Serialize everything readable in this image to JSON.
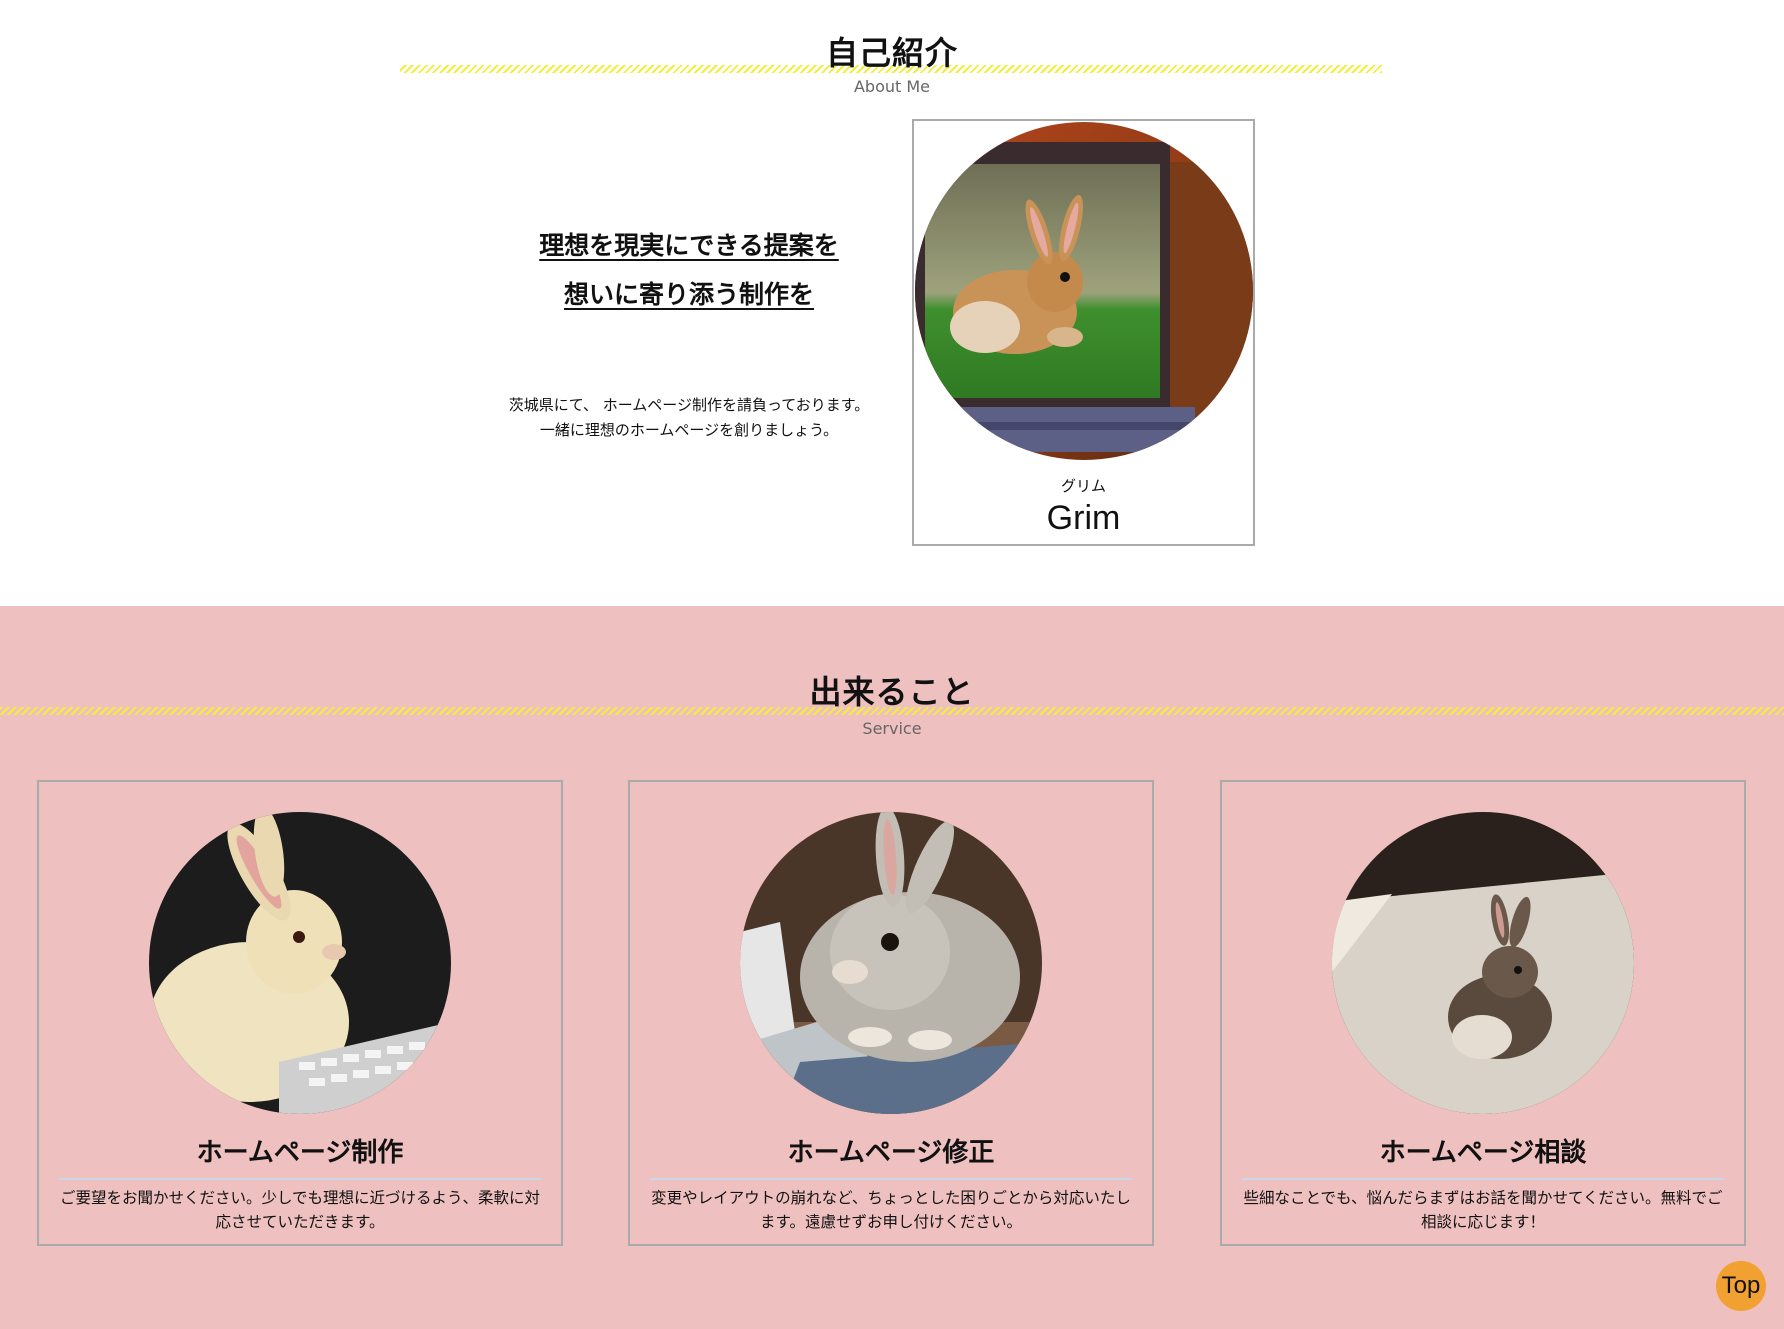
{
  "about": {
    "title": "自己紹介",
    "subtitle": "About Me",
    "catch_line1": "理想を現実にできる提案を",
    "catch_line2": "想いに寄り添う制作を",
    "intro_line1": "茨城県にて、 ホームページ制作を請負っております。",
    "intro_line2": "一緒に理想のホームページを創りましょう。",
    "profile": {
      "ruby": "グリム",
      "name": "Grim",
      "photo": "rabbit-with-laptop-image"
    }
  },
  "service": {
    "title": "出来ること",
    "subtitle": "Service",
    "cards": [
      {
        "title": "ホームページ制作",
        "text": "ご要望をお聞かせください。少しでも理想に近づけるよう、柔軟に対応させていただきます。",
        "photo": "rabbit-keyboard-image"
      },
      {
        "title": "ホームページ修正",
        "text": "変更やレイアウトの崩れなど、ちょっとした困りごとから対応いたします。遠慮せずお申し付けください。",
        "photo": "rabbit-laptop-desk-image"
      },
      {
        "title": "ホームページ相談",
        "text": "些細なことでも、悩んだらまずはお話を聞かせてください。無料でご相談に応じます！",
        "photo": "small-rabbit-image"
      }
    ]
  },
  "top_button": {
    "label": "Top"
  },
  "colors": {
    "service_bg": "#efc0c0",
    "stripe": "#f3ee3c",
    "top_button": "#f0a132"
  }
}
